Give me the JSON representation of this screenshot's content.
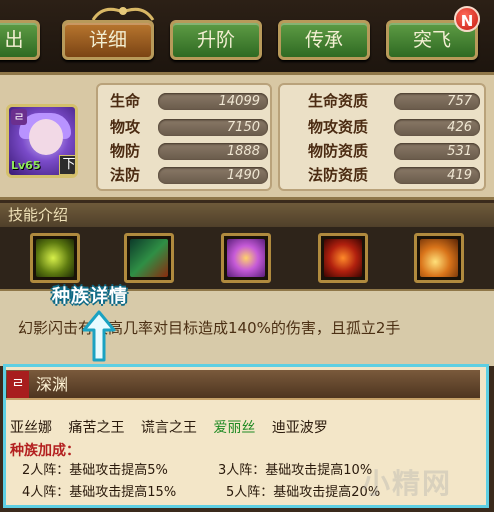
{
  "tabs": [
    {
      "label": "出",
      "active": false
    },
    {
      "label": "详细",
      "active": true
    },
    {
      "label": "升阶",
      "active": false
    },
    {
      "label": "传承",
      "active": false
    },
    {
      "label": "突飞",
      "active": false
    }
  ],
  "notification_badge": "N",
  "hero": {
    "race_icon": "ㄹ",
    "level": "Lv65",
    "grade": "下"
  },
  "stats_left": [
    {
      "label": "生命",
      "value": "14099"
    },
    {
      "label": "物攻",
      "value": "7150"
    },
    {
      "label": "物防",
      "value": "1888"
    },
    {
      "label": "法防",
      "value": "1490"
    }
  ],
  "stats_right": [
    {
      "label": "生命资质",
      "value": "757"
    },
    {
      "label": "物攻资质",
      "value": "426"
    },
    {
      "label": "物防资质",
      "value": "531"
    },
    {
      "label": "法防资质",
      "value": "419"
    }
  ],
  "skills": {
    "header": "技能介绍",
    "icons": [
      "skill-1-icon",
      "skill-2-icon",
      "skill-3-icon",
      "skill-4-icon",
      "skill-5-icon"
    ],
    "description": "幻影闪击有较高几率对目标造成140%的伤害，且孤立2手"
  },
  "callout": "种族详情",
  "race": {
    "emblem": "ㄹ",
    "name": "深渊",
    "members": [
      {
        "name": "亚丝娜",
        "highlight": false
      },
      {
        "name": "痛苦之王",
        "highlight": false
      },
      {
        "name": "谎言之王",
        "highlight": false
      },
      {
        "name": "爱丽丝",
        "highlight": true
      },
      {
        "name": "迪亚波罗",
        "highlight": false
      }
    ],
    "bonus_title": "种族加成：",
    "bonuses": [
      "2人阵：基础攻击提高5%",
      "3人阵：基础攻击提高10%",
      "4人阵：基础攻击提高15%",
      "5人阵：基础攻击提高20%"
    ]
  },
  "watermark": "小精网",
  "colors": {
    "tab_green": "#4a8a37",
    "tab_active": "#9a5c22",
    "popup_border": "#5ecfe3",
    "race_title_bg": "#6a4a2e",
    "bonus_title": "#b31f1f",
    "highlight_member": "#1f8a23"
  }
}
